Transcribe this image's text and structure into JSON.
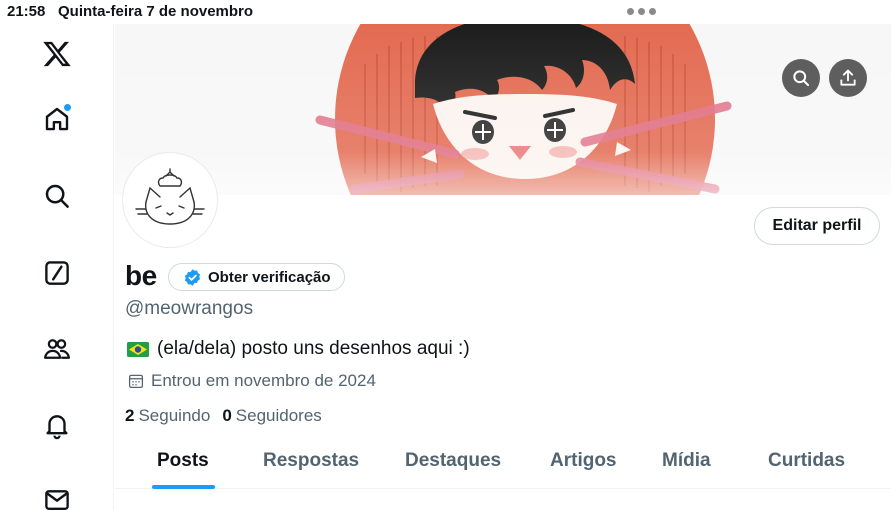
{
  "status_bar": {
    "time": "21:58",
    "date": "Quinta-feira 7 de novembro"
  },
  "sidebar": {
    "items": [
      {
        "name": "x-logo-icon"
      },
      {
        "name": "home-icon",
        "has_notification_dot": true
      },
      {
        "name": "search-icon"
      },
      {
        "name": "compose-icon"
      },
      {
        "name": "communities-icon"
      },
      {
        "name": "notifications-icon"
      },
      {
        "name": "messages-icon"
      }
    ]
  },
  "banner": {
    "icons": [
      "search-icon",
      "share-icon"
    ]
  },
  "profile": {
    "display_name": "be",
    "verify_label": "Obter verificação",
    "handle": "@meowrangos",
    "bio": "(ela/dela) posto uns desenhos aqui :)",
    "bio_flag": "brazil-flag",
    "joined": "Entrou em novembro de 2024",
    "following_count": "2",
    "following_label": "Seguindo",
    "followers_count": "0",
    "followers_label": "Seguidores",
    "edit_label": "Editar perfil"
  },
  "tabs": [
    {
      "label": "Posts",
      "active": true
    },
    {
      "label": "Respostas",
      "active": false
    },
    {
      "label": "Destaques",
      "active": false
    },
    {
      "label": "Artigos",
      "active": false
    },
    {
      "label": "Mídia",
      "active": false
    },
    {
      "label": "Curtidas",
      "active": false
    }
  ],
  "colors": {
    "accent": "#1d9bf0",
    "text": "#0f1419",
    "secondary": "#536471",
    "banner_red": "#e0694f"
  }
}
